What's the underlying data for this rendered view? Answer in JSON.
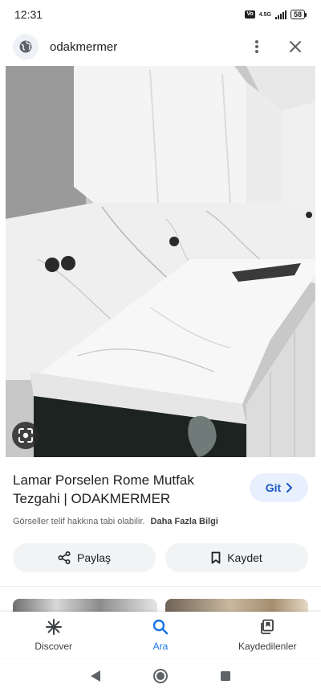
{
  "status_bar": {
    "time": "12:31",
    "vo_label": "Vo",
    "network_label": "4.5G",
    "battery": "58"
  },
  "header": {
    "site_name": "odakmermer",
    "site_icon": "globe-icon",
    "menu_icon": "more-vert-icon",
    "close_icon": "close-icon"
  },
  "image": {
    "subject": "white marble porcelain kitchen countertop",
    "lens_icon": "google-lens-icon"
  },
  "result": {
    "title": "Lamar Porselen Rome Mutfak Tezgahi | ODAKMERMER",
    "visit_label": "Git",
    "copyright_text": "Görseller telif hakkına tabi olabilir.",
    "more_info_label": "Daha Fazla Bilgi"
  },
  "actions": {
    "share_label": "Paylaş",
    "save_label": "Kaydet"
  },
  "bottom_nav": {
    "items": [
      {
        "label": "Discover",
        "icon": "asterisk-icon",
        "active": false
      },
      {
        "label": "Ara",
        "icon": "search-icon",
        "active": true
      },
      {
        "label": "Kaydedilenler",
        "icon": "collections-icon",
        "active": false
      }
    ]
  },
  "system_nav": {
    "back_icon": "back-triangle-icon",
    "home_icon": "home-circle-icon",
    "recents_icon": "recents-square-icon"
  },
  "colors": {
    "accent": "#1a73e8",
    "git_bg": "#e8f0fe",
    "pill_bg": "#f1f3f4"
  }
}
